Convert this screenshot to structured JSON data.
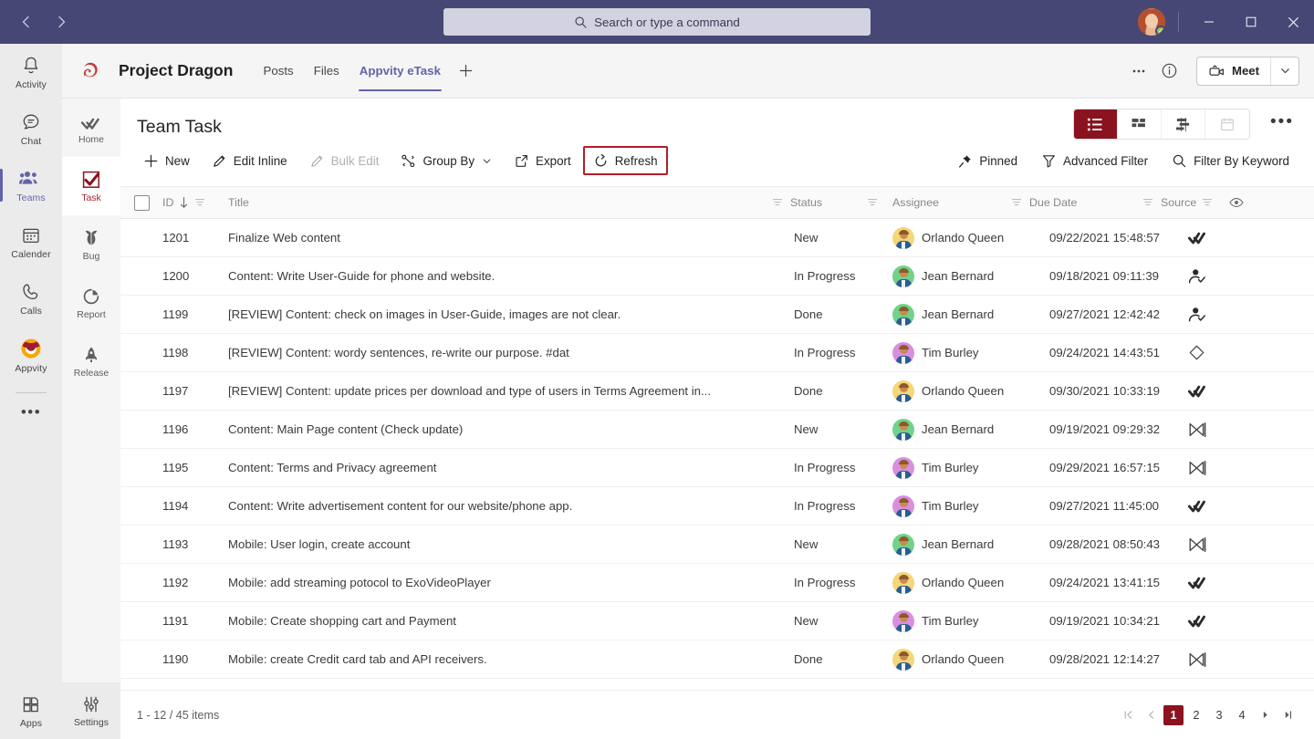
{
  "titlebar": {
    "back_label": "Back",
    "forward_label": "Forward",
    "search_placeholder": "Search or type a command",
    "minimize_label": "Minimize",
    "maximize_label": "Maximize",
    "close_label": "Close",
    "presence": "Available"
  },
  "rail": {
    "items": [
      {
        "label": "Activity",
        "icon": "bell-icon"
      },
      {
        "label": "Chat",
        "icon": "chat-icon"
      },
      {
        "label": "Teams",
        "icon": "teams-icon"
      },
      {
        "label": "Calender",
        "icon": "calendar-icon"
      },
      {
        "label": "Calls",
        "icon": "phone-icon"
      },
      {
        "label": "Appvity",
        "icon": "appvity-icon"
      }
    ],
    "active": "Teams",
    "more_label": "•••",
    "apps_label": "Apps"
  },
  "team_header": {
    "team_name": "Project Dragon",
    "tabs": [
      {
        "label": "Posts"
      },
      {
        "label": "Files"
      },
      {
        "label": "Appvity eTask"
      }
    ],
    "active_tab": "Appvity eTask",
    "add_tab_label": "+",
    "more_label": "•••",
    "info_label": "i",
    "meet_label": "Meet"
  },
  "subrail": {
    "items": [
      {
        "label": "Home",
        "icon": "home-check-icon"
      },
      {
        "label": "Task",
        "icon": "task-check-icon"
      },
      {
        "label": "Bug",
        "icon": "bug-icon"
      },
      {
        "label": "Report",
        "icon": "report-pie-icon"
      },
      {
        "label": "Release",
        "icon": "rocket-icon"
      }
    ],
    "active": "Task",
    "settings_label": "Settings"
  },
  "main": {
    "page_title": "Team Task",
    "toolbar": {
      "new": "New",
      "edit_inline": "Edit Inline",
      "bulk_edit": "Bulk Edit",
      "group_by": "Group By",
      "export": "Export",
      "refresh": "Refresh",
      "pinned": "Pinned",
      "advanced_filter": "Advanced Filter",
      "filter_by_keyword": "Filter By Keyword",
      "highlighted_button": "Refresh",
      "highlight_color": "#b01e28"
    },
    "view_switcher": {
      "views": [
        {
          "name": "list-view",
          "active": true
        },
        {
          "name": "board-view",
          "active": false
        },
        {
          "name": "gantt-view",
          "active": false
        },
        {
          "name": "calendar-view",
          "active": false,
          "disabled": true
        }
      ],
      "active_color": "#8b1320"
    },
    "more_options_label": "•••",
    "table": {
      "columns": [
        "ID",
        "Title",
        "Status",
        "Assignee",
        "Due Date",
        "Source"
      ],
      "rows": [
        {
          "id": "1201",
          "title": "Finalize Web content",
          "status": "New",
          "assignee": "Orlando Queen",
          "avatar_color": "#f5d678",
          "due_date": "09/22/2021 15:48:57",
          "source": "task-double-check-icon"
        },
        {
          "id": "1200",
          "title": "Content: Write User-Guide for phone and website.",
          "status": "In Progress",
          "assignee": "Jean Bernard",
          "avatar_color": "#6fd38a",
          "due_date": "09/18/2021 09:11:39",
          "source": "person-check-icon"
        },
        {
          "id": "1199",
          "title": "[REVIEW] Content: check on images in User-Guide, images are not clear.",
          "status": "Done",
          "assignee": "Jean Bernard",
          "avatar_color": "#6fd38a",
          "due_date": "09/27/2021 12:42:42",
          "source": "person-check-icon"
        },
        {
          "id": "1198",
          "title": "[REVIEW] Content: wordy sentences, re-write our purpose. #dat",
          "status": "In Progress",
          "assignee": "Tim Burley",
          "avatar_color": "#d98fe0",
          "due_date": "09/24/2021 14:43:51",
          "source": "diamond-icon"
        },
        {
          "id": "1197",
          "title": "[REVIEW] Content: update prices per download and type of users in Terms Agreement in...",
          "status": "Done",
          "assignee": "Orlando Queen",
          "avatar_color": "#f5d678",
          "due_date": "09/30/2021 10:33:19",
          "source": "task-double-check-icon"
        },
        {
          "id": "1196",
          "title": "Content: Main Page content (Check update)",
          "status": "New",
          "assignee": "Jean Bernard",
          "avatar_color": "#6fd38a",
          "due_date": "09/19/2021 09:29:32",
          "source": "planner-bowtie-icon"
        },
        {
          "id": "1195",
          "title": "Content: Terms and Privacy agreement",
          "status": "In Progress",
          "assignee": "Tim Burley",
          "avatar_color": "#d98fe0",
          "due_date": "09/29/2021 16:57:15",
          "source": "planner-bowtie-icon"
        },
        {
          "id": "1194",
          "title": "Content: Write advertisement content for our website/phone app.",
          "status": "In Progress",
          "assignee": "Tim Burley",
          "avatar_color": "#d98fe0",
          "due_date": "09/27/2021 11:45:00",
          "source": "task-double-check-icon"
        },
        {
          "id": "1193",
          "title": "Mobile: User login, create account",
          "status": "New",
          "assignee": "Jean Bernard",
          "avatar_color": "#6fd38a",
          "due_date": "09/28/2021 08:50:43",
          "source": "planner-bowtie-icon"
        },
        {
          "id": "1192",
          "title": "Mobile: add streaming potocol to ExoVideoPlayer",
          "status": "In Progress",
          "assignee": "Orlando Queen",
          "avatar_color": "#f5d678",
          "due_date": "09/24/2021 13:41:15",
          "source": "task-double-check-icon"
        },
        {
          "id": "1191",
          "title": "Mobile: Create shopping cart and Payment",
          "status": "New",
          "assignee": "Tim Burley",
          "avatar_color": "#d98fe0",
          "due_date": "09/19/2021 10:34:21",
          "source": "task-double-check-icon"
        },
        {
          "id": "1190",
          "title": "Mobile: create Credit card tab and API receivers.",
          "status": "Done",
          "assignee": "Orlando Queen",
          "avatar_color": "#f5d678",
          "due_date": "09/28/2021 12:14:27",
          "source": "planner-bowtie-icon"
        }
      ]
    },
    "footer": {
      "items_count": "1 - 12 / 45 items",
      "pages": [
        "1",
        "2",
        "3",
        "4"
      ],
      "active_page": "1",
      "first_label": "|◀",
      "prev_label": "◀",
      "next_label": "▶",
      "last_label": "▶|"
    }
  },
  "colors": {
    "teams_purple": "#464775",
    "accent_red": "#8b1320",
    "highlight_red": "#b01e28"
  }
}
